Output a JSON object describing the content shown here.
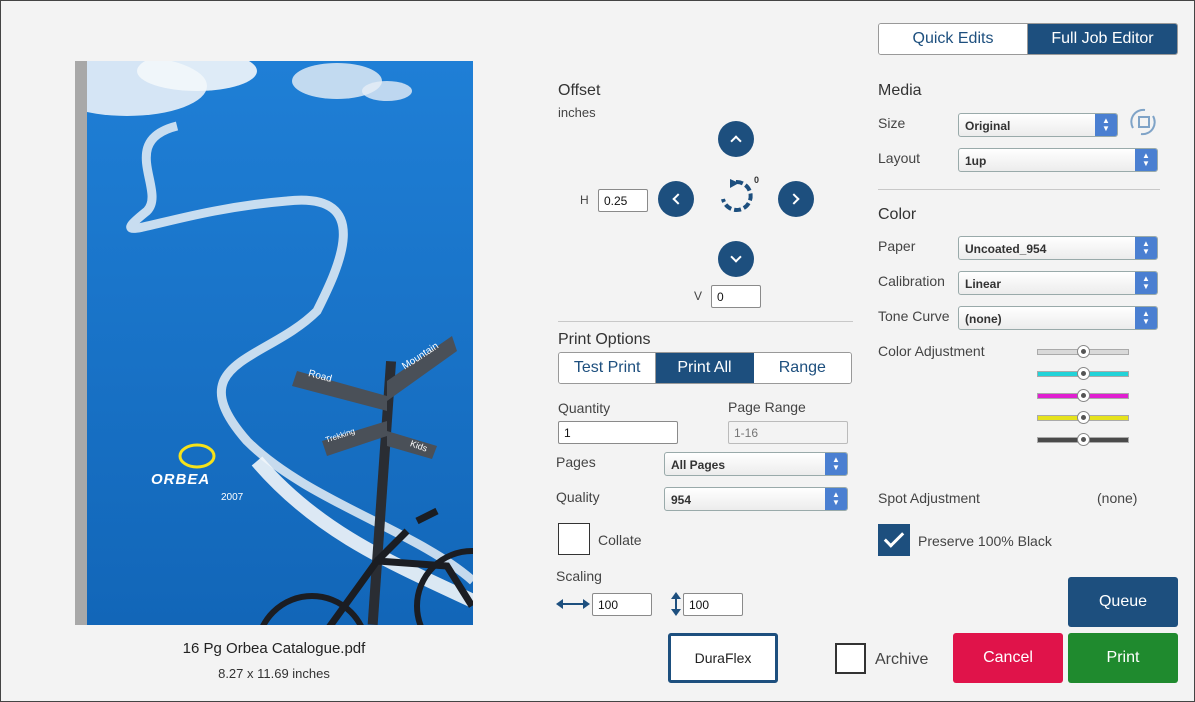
{
  "mode_tabs": [
    {
      "label": "Quick Edits",
      "active": false
    },
    {
      "label": "Full Job Editor",
      "active": true
    }
  ],
  "preview": {
    "file_name": "16 Pg Orbea Catalogue.pdf",
    "dimensions": "8.27 x 11.69 inches",
    "image_brand": "ORBEA",
    "image_year": "2007",
    "sign_texts": [
      "Road",
      "Mountain",
      "Trekking",
      "Kids"
    ]
  },
  "offset": {
    "title": "Offset",
    "unit": "inches",
    "h_label": "H",
    "h_value": "0.25",
    "v_label": "V",
    "v_value": "0",
    "rotation_degree": "0"
  },
  "print_options": {
    "title": "Print Options",
    "modes": [
      {
        "label": "Test Print",
        "active": false
      },
      {
        "label": "Print All",
        "active": true
      },
      {
        "label": "Range",
        "active": false
      }
    ],
    "quantity_label": "Quantity",
    "quantity_value": "1",
    "page_range_label": "Page Range",
    "page_range_placeholder": "1-16",
    "pages_label": "Pages",
    "pages_value": "All Pages",
    "quality_label": "Quality",
    "quality_value": "954",
    "collate_label": "Collate",
    "collate_checked": false,
    "scaling_label": "Scaling",
    "scale_width": "100",
    "scale_height": "100"
  },
  "media": {
    "title": "Media",
    "size_label": "Size",
    "size_value": "Original",
    "layout_label": "Layout",
    "layout_value": "1up"
  },
  "color": {
    "title": "Color",
    "paper_label": "Paper",
    "paper_value": "Uncoated_954",
    "calibration_label": "Calibration",
    "calibration_value": "Linear",
    "tone_curve_label": "Tone Curve",
    "tone_curve_value": "(none)",
    "adjustment_label": "Color Adjustment",
    "sliders": [
      {
        "channel": "master",
        "color": "#d9d9d9",
        "level": 0.5
      },
      {
        "channel": "cyan",
        "color": "#22d3d8",
        "level": 0.5
      },
      {
        "channel": "magenta",
        "color": "#e01fd0",
        "level": 0.5
      },
      {
        "channel": "yellow",
        "color": "#e6e21c",
        "level": 0.5
      },
      {
        "channel": "black",
        "color": "#4a4a4a",
        "level": 0.5
      }
    ],
    "spot_label": "Spot Adjustment",
    "spot_value": "(none)",
    "preserve_black_label": "Preserve 100% Black",
    "preserve_black_checked": true
  },
  "actions": {
    "duraflex": "DuraFlex",
    "archive_label": "Archive",
    "archive_checked": false,
    "queue": "Queue",
    "cancel": "Cancel",
    "print": "Print"
  },
  "colors": {
    "accent": "#1d4f7e",
    "cancel": "#e0134a",
    "print": "#1f8a2e",
    "select_arrow": "#4a7fd1"
  }
}
